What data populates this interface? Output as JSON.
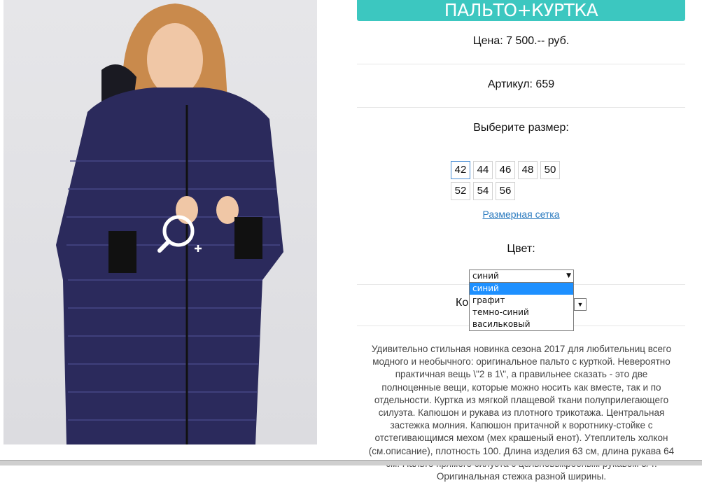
{
  "product": {
    "title": "ПАЛЬТО+КУРТКА",
    "price": "Цена: 7 500.-- руб.",
    "article": "Артикул: 659",
    "size_prompt": "Выберите размер:",
    "sizes": [
      "42",
      "44",
      "46",
      "48",
      "50",
      "52",
      "54",
      "56"
    ],
    "selected_size": "42",
    "size_chart_link": "Размерная сетка",
    "color_label": "Цвет:",
    "color_selected": "синий",
    "color_options": [
      "синий",
      "графит",
      "темно-синий",
      "васильковый"
    ],
    "qty_label_partial": "Ко",
    "description": "Удивительно стильная новинка  сезона 2017 для любительниц всего модного  и необычного: оригинальное пальто с курткой. Невероятно практичная вещь \\\"2 в 1\\\", а правильнее сказать - это две полноценные вещи, которые можно носить как вместе, так и по отдельности. Куртка из мягкой плащевой ткани полуприлегающего силуэта. Капюшон и рукава из плотного трикотажа. Центральная застежка молния. Капюшон притачной к воротнику-стойке с отстегивающимся мехом (мех крашеный енот). Утеплитель холкон (см.описание), плотность 100. Длина изделия 63 см, длина рукава 64 см. Пальто прямого силуэта с цельновыкроеным рукавом 3/4. Оригинальная стежка разной ширины."
  },
  "icons": {
    "zoom": "zoom-in-icon"
  },
  "colors": {
    "accent": "#3cc7c0",
    "link": "#2a7abf",
    "dropdown_highlight": "#1e90ff"
  }
}
